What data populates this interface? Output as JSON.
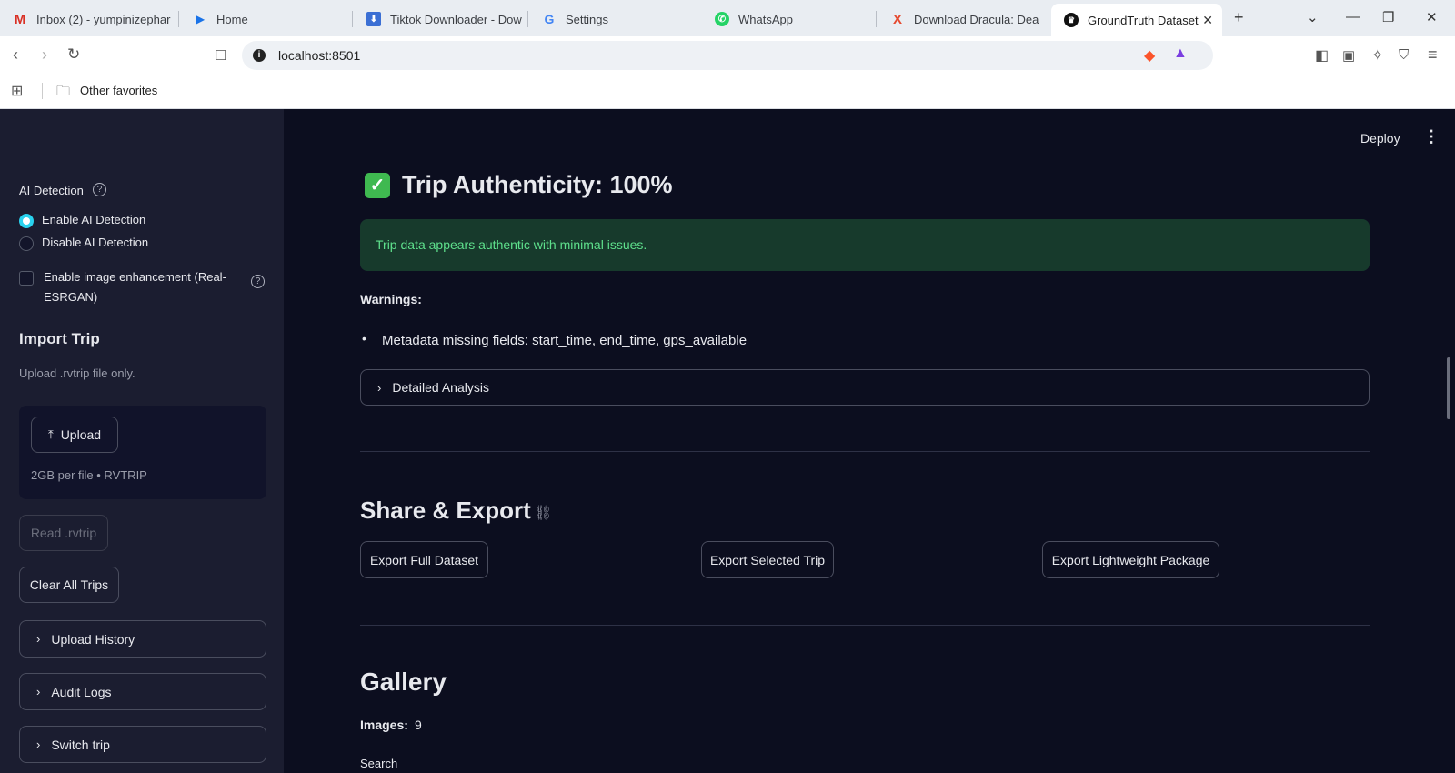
{
  "browser": {
    "tabs": [
      {
        "label": "Inbox (2) - yumpinizephar",
        "icon": "gmail-icon"
      },
      {
        "label": "Home",
        "icon": "home-icon"
      },
      {
        "label": "Tiktok Downloader - Dow",
        "icon": "download-icon"
      },
      {
        "label": "Settings",
        "icon": "google-icon"
      },
      {
        "label": "WhatsApp",
        "icon": "whatsapp-icon"
      },
      {
        "label": "Download Dracula: Dead",
        "icon": "x-icon"
      },
      {
        "label": "GroundTruth Dataset",
        "icon": "crown-icon"
      }
    ],
    "url": "localhost:8501",
    "favorites": "Other favorites"
  },
  "sidebar": {
    "ai_detection_label": "AI Detection",
    "radio_options": [
      "Enable AI Detection",
      "Disable AI Detection"
    ],
    "selected_option": "Enable AI Detection",
    "enhancement_checkbox": [
      "Enable image enhancement (Real-",
      "ESRGAN)"
    ],
    "import_title": "Import Trip",
    "upload_hint": "Upload .rvtrip file only.",
    "upload_button": "Upload",
    "upload_limit": "2GB per file • RVTRIP",
    "read_button": "Read .rvtrip",
    "clear_button": "Clear All Trips",
    "expanders": [
      "Upload History",
      "Audit Logs",
      "Switch trip"
    ]
  },
  "header": {
    "deploy": "Deploy"
  },
  "main": {
    "authenticity_title": "Trip Authenticity: 100%",
    "success_message": "Trip data appears authentic with minimal issues.",
    "warnings_label": "Warnings:",
    "warning_item": "Metadata missing fields: start_time, end_time, gps_available",
    "detailed_analysis": "Detailed Analysis",
    "share_title": "Share & Export",
    "export_buttons": [
      "Export Full Dataset",
      "Export Selected Trip",
      "Export Lightweight Package"
    ],
    "gallery_title": "Gallery",
    "images_label": "Images:",
    "images_count": "9",
    "search_label": "Search"
  }
}
